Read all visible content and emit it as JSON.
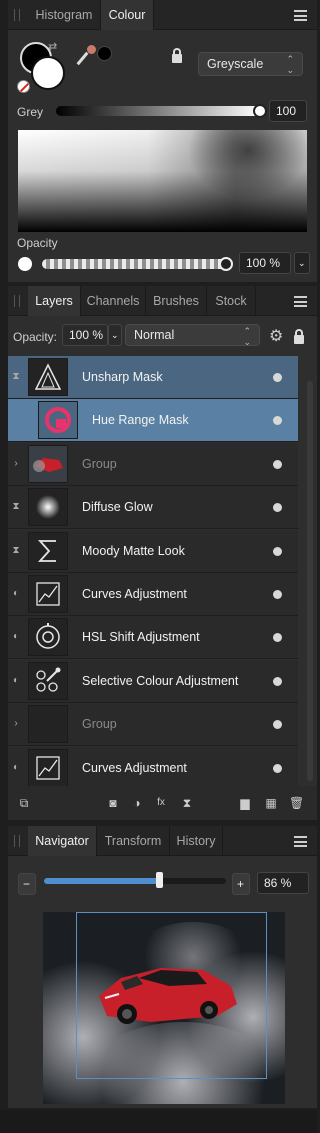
{
  "colour_panel": {
    "tabs": [
      {
        "label": "Histogram",
        "active": false
      },
      {
        "label": "Colour",
        "active": true
      }
    ],
    "mode": "Greyscale",
    "grey_label": "Grey",
    "grey_value": "100",
    "grey_level": 1.0,
    "opacity_label": "Opacity",
    "opacity_value": "100 %",
    "opacity_level": 1.0
  },
  "layers_panel": {
    "tabs": [
      {
        "label": "Layers",
        "active": true
      },
      {
        "label": "Channels",
        "active": false
      },
      {
        "label": "Brushes",
        "active": false
      },
      {
        "label": "Stock",
        "active": false
      }
    ],
    "opacity_label": "Opacity:",
    "opacity_value": "100 %",
    "blend_mode": "Normal",
    "layers": [
      {
        "name": "Unsharp Mask",
        "icon": "unsharp-mask-icon",
        "selected": true,
        "dim": false,
        "expander": "hourglass-icon"
      },
      {
        "name": "Hue Range Mask",
        "icon": "hue-range-mask-icon",
        "selected": true,
        "dim": false,
        "expander": ""
      },
      {
        "name": "Group",
        "icon": "car-thumbnail",
        "selected": false,
        "dim": true,
        "expander": "chevron-right-icon"
      },
      {
        "name": "Diffuse Glow",
        "icon": "diffuse-glow-icon",
        "selected": false,
        "dim": false,
        "expander": "hourglass-icon"
      },
      {
        "name": "Moody Matte Look",
        "icon": "sigma-icon",
        "selected": false,
        "dim": false,
        "expander": "hourglass-icon"
      },
      {
        "name": "Curves Adjustment",
        "icon": "curves-icon",
        "selected": false,
        "dim": false,
        "expander": "adjustment-icon"
      },
      {
        "name": "HSL Shift Adjustment",
        "icon": "hsl-icon",
        "selected": false,
        "dim": false,
        "expander": "adjustment-icon"
      },
      {
        "name": "Selective Colour Adjustment",
        "icon": "selective-colour-icon",
        "selected": false,
        "dim": false,
        "expander": "adjustment-icon"
      },
      {
        "name": "Group",
        "icon": "empty-thumbnail",
        "selected": false,
        "dim": true,
        "expander": "chevron-right-icon"
      },
      {
        "name": "Curves Adjustment",
        "icon": "curves-icon",
        "selected": false,
        "dim": false,
        "expander": "adjustment-icon"
      }
    ]
  },
  "navigator_panel": {
    "tabs": [
      {
        "label": "Navigator",
        "active": true
      },
      {
        "label": "Transform",
        "active": false
      },
      {
        "label": "History",
        "active": false
      }
    ],
    "zoom_value": "86 %",
    "zoom_level": 0.63,
    "minus": "−",
    "plus": "+"
  },
  "colors": {
    "accent_selected": "#4b6681",
    "accent_selected_light": "#5a80a4",
    "viewbox": "#5d8fc7",
    "mask_pink": "#e8336b"
  }
}
